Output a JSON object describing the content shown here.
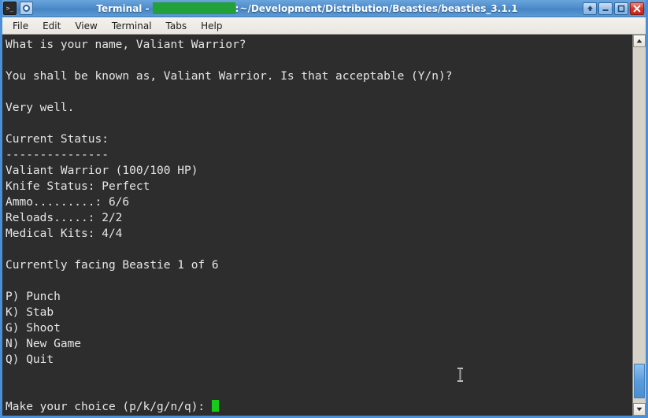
{
  "window": {
    "title_prefix": "Terminal -",
    "title_redacted": true,
    "title_separator": ":",
    "title_path": "~/Development/Distribution/Beasties/beasties_3.1.1",
    "icons": {
      "terminal_icon": "terminal-icon",
      "circle_icon": "circle-icon"
    },
    "controls": [
      {
        "name": "shade-button",
        "glyph": "up-arrow-icon",
        "label": "Shade"
      },
      {
        "name": "minimize-button",
        "glyph": "minimize-icon",
        "label": "Minimize"
      },
      {
        "name": "maximize-button",
        "glyph": "maximize-icon",
        "label": "Maximize"
      },
      {
        "name": "close-button",
        "glyph": "close-icon",
        "label": "Close"
      }
    ],
    "colors": {
      "titlebar_accent": "#4a90d9",
      "redaction": "#22a03a",
      "close_button": "#d8392a",
      "terminal_bg": "#2d2d2d",
      "terminal_fg": "#e6e6e6",
      "cursor": "#19c919",
      "scrollbar_thumb": "#5b9bdb"
    }
  },
  "menubar": {
    "items": [
      {
        "label": "File"
      },
      {
        "label": "Edit"
      },
      {
        "label": "View"
      },
      {
        "label": "Terminal"
      },
      {
        "label": "Tabs"
      },
      {
        "label": "Help"
      }
    ]
  },
  "terminal": {
    "lines": [
      "What is your name, Valiant Warrior?",
      "",
      "You shall be known as, Valiant Warrior. Is that acceptable (Y/n)?",
      "",
      "Very well.",
      "",
      "Current Status:",
      "---------------",
      "Valiant Warrior (100/100 HP)",
      "Knife Status: Perfect",
      "Ammo.........: 6/6",
      "Reloads.....: 2/2",
      "Medical Kits: 4/4",
      "",
      "Currently facing Beastie 1 of 6",
      "",
      "P) Punch",
      "K) Stab",
      "G) Shoot",
      "N) New Game",
      "Q) Quit",
      "",
      ""
    ],
    "prompt": "Make your choice (p/k/g/n/q): ",
    "cursor_visible": true,
    "status": {
      "heading": "Current Status:",
      "player_name": "Valiant Warrior",
      "hp": "100/100 HP",
      "knife_status": "Perfect",
      "ammo": "6/6",
      "reloads": "2/2",
      "medical_kits": "4/4",
      "facing": "Beastie 1 of 6"
    },
    "menu_options": [
      {
        "key": "P",
        "label": "Punch"
      },
      {
        "key": "K",
        "label": "Stab"
      },
      {
        "key": "G",
        "label": "Shoot"
      },
      {
        "key": "N",
        "label": "New Game"
      },
      {
        "key": "Q",
        "label": "Quit"
      }
    ]
  },
  "scrollbar": {
    "up_arrow": "▲",
    "down_arrow": "▼",
    "position": "near-bottom"
  }
}
